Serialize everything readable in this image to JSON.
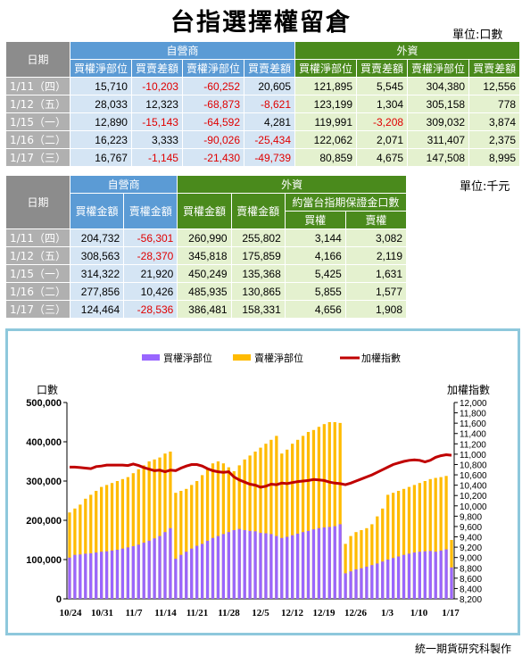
{
  "title": "台指選擇權留倉",
  "unit1": "單位:口數",
  "unit2": "單位:千元",
  "table1": {
    "date_header": "日期",
    "group1": "自營商",
    "group2": "外資",
    "cols": [
      "買權淨部位",
      "買賣差額",
      "賣權淨部位",
      "買賣差額",
      "買權淨部位",
      "買賣差額",
      "賣權淨部位",
      "買賣差額"
    ],
    "rows": [
      {
        "date": "1/11（四）",
        "v": [
          "15,710",
          "-10,203",
          "-60,252",
          "20,605",
          "121,895",
          "5,545",
          "304,380",
          "12,556"
        ]
      },
      {
        "date": "1/12（五）",
        "v": [
          "28,033",
          "12,323",
          "-68,873",
          "-8,621",
          "123,199",
          "1,304",
          "305,158",
          "778"
        ]
      },
      {
        "date": "1/15（一）",
        "v": [
          "12,890",
          "-15,143",
          "-64,592",
          "4,281",
          "119,991",
          "-3,208",
          "309,032",
          "3,874"
        ]
      },
      {
        "date": "1/16（二）",
        "v": [
          "16,223",
          "3,333",
          "-90,026",
          "-25,434",
          "122,062",
          "2,071",
          "311,407",
          "2,375"
        ]
      },
      {
        "date": "1/17（三）",
        "v": [
          "16,767",
          "-1,145",
          "-21,430",
          "-49,739",
          "80,859",
          "4,675",
          "147,508",
          "8,995"
        ]
      }
    ]
  },
  "table2": {
    "date_header": "日期",
    "group1": "自營商",
    "group2": "外資",
    "subgroup": "約當台指期保證金口數",
    "cols": [
      "買權金額",
      "賣權金額",
      "買權金額",
      "賣權金額",
      "買權",
      "賣權"
    ],
    "rows": [
      {
        "date": "1/11（四）",
        "v": [
          "204,732",
          "-56,301",
          "260,990",
          "255,802",
          "3,144",
          "3,082"
        ]
      },
      {
        "date": "1/12（五）",
        "v": [
          "308,563",
          "-28,370",
          "345,818",
          "175,859",
          "4,166",
          "2,119"
        ]
      },
      {
        "date": "1/15（一）",
        "v": [
          "314,322",
          "21,920",
          "450,249",
          "135,368",
          "5,425",
          "1,631"
        ]
      },
      {
        "date": "1/16（二）",
        "v": [
          "277,856",
          "10,426",
          "485,935",
          "130,865",
          "5,855",
          "1,577"
        ]
      },
      {
        "date": "1/17（三）",
        "v": [
          "124,464",
          "-28,536",
          "386,481",
          "158,331",
          "4,656",
          "1,908"
        ]
      }
    ]
  },
  "chart_data": {
    "type": "bar",
    "ylabel": "口數",
    "y2label": "加權指數",
    "ylim": [
      0,
      500000
    ],
    "y2lim": [
      8200,
      12000
    ],
    "yticks": [
      "0",
      "100,000",
      "200,000",
      "300,000",
      "400,000",
      "500,000"
    ],
    "y2ticks": [
      "8,200",
      "8,400",
      "8,600",
      "8,800",
      "9,000",
      "9,200",
      "9,400",
      "9,600",
      "9,800",
      "10,000",
      "10,200",
      "10,400",
      "10,600",
      "10,800",
      "11,000",
      "11,200",
      "11,400",
      "11,600",
      "11,800",
      "12,000"
    ],
    "xticks": [
      "10/24",
      "10/31",
      "11/7",
      "11/14",
      "11/21",
      "11/28",
      "12/5",
      "12/12",
      "12/19",
      "12/26",
      "1/3",
      "1/10",
      "1/17"
    ],
    "legend": [
      "買權淨部位",
      "賣權淨部位",
      "加權指數"
    ],
    "legend_position": "top",
    "series": [
      {
        "name": "買權淨部位",
        "color": "#9966ff",
        "values": [
          105000,
          112000,
          113000,
          115000,
          116000,
          118000,
          120000,
          121000,
          123000,
          125000,
          128000,
          131000,
          134000,
          138000,
          143000,
          148000,
          154000,
          160000,
          170000,
          180000,
          102000,
          112000,
          120000,
          128000,
          135000,
          140000,
          148000,
          155000,
          160000,
          165000,
          170000,
          175000,
          178000,
          175000,
          173000,
          172000,
          168000,
          167000,
          165000,
          160000,
          155000,
          158000,
          162000,
          166000,
          170000,
          173000,
          177000,
          180000,
          182000,
          183000,
          185000,
          190000,
          65000,
          70000,
          75000,
          78000,
          82000,
          86000,
          90000,
          95000,
          100000,
          104000,
          108000,
          112000,
          115000,
          118000,
          120000,
          121000,
          122000,
          120000,
          123000,
          126000,
          80000
        ]
      },
      {
        "name": "賣權淨部位",
        "color": "#ffbb00",
        "values": [
          220000,
          230000,
          240000,
          255000,
          265000,
          275000,
          285000,
          290000,
          295000,
          300000,
          305000,
          310000,
          320000,
          330000,
          340000,
          350000,
          355000,
          360000,
          370000,
          375000,
          270000,
          275000,
          280000,
          290000,
          300000,
          315000,
          330000,
          345000,
          350000,
          345000,
          335000,
          325000,
          340000,
          355000,
          365000,
          375000,
          385000,
          395000,
          405000,
          415000,
          370000,
          380000,
          395000,
          405000,
          415000,
          425000,
          430000,
          438000,
          445000,
          450000,
          450000,
          448000,
          140000,
          160000,
          170000,
          175000,
          180000,
          190000,
          210000,
          230000,
          265000,
          270000,
          275000,
          280000,
          285000,
          290000,
          295000,
          300000,
          305000,
          308000,
          310000,
          313000,
          150000
        ]
      },
      {
        "name": "加權指數",
        "color": "#c00000",
        "values": [
          10750,
          10750,
          10740,
          10730,
          10720,
          10760,
          10770,
          10790,
          10790,
          10790,
          10790,
          10780,
          10810,
          10780,
          10740,
          10710,
          10680,
          10690,
          10660,
          10690,
          10680,
          10730,
          10770,
          10800,
          10800,
          10770,
          10720,
          10680,
          10660,
          10650,
          10660,
          10560,
          10500,
          10460,
          10420,
          10400,
          10360,
          10380,
          10420,
          10410,
          10440,
          10430,
          10450,
          10470,
          10480,
          10490,
          10510,
          10500,
          10490,
          10460,
          10440,
          10430,
          10410,
          10440,
          10480,
          10520,
          10560,
          10600,
          10650,
          10700,
          10750,
          10800,
          10830,
          10860,
          10880,
          10890,
          10880,
          10850,
          10880,
          10940,
          10970,
          10990,
          10980
        ]
      }
    ]
  },
  "footer": "統一期貨研究科製作"
}
